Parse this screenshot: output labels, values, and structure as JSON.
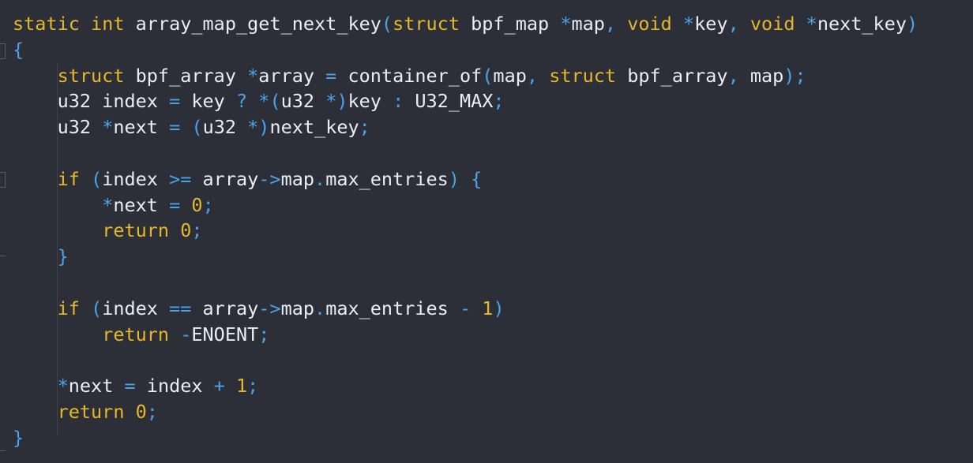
{
  "colors": {
    "background": "#2c2f38",
    "keyword": "#e5b82a",
    "identifier": "#e9eef5",
    "operator": "#4aa3e8"
  },
  "code": {
    "lines": [
      [
        [
          "kw",
          "static"
        ],
        [
          "id",
          " "
        ],
        [
          "kw",
          "int"
        ],
        [
          "id",
          " array_map_get_next_key"
        ],
        [
          "op",
          "("
        ],
        [
          "kw",
          "struct"
        ],
        [
          "id",
          " bpf_map "
        ],
        [
          "op",
          "*"
        ],
        [
          "id",
          "map"
        ],
        [
          "op",
          ","
        ],
        [
          "id",
          " "
        ],
        [
          "kw",
          "void"
        ],
        [
          "id",
          " "
        ],
        [
          "op",
          "*"
        ],
        [
          "id",
          "key"
        ],
        [
          "op",
          ","
        ],
        [
          "id",
          " "
        ],
        [
          "kw",
          "void"
        ],
        [
          "id",
          " "
        ],
        [
          "op",
          "*"
        ],
        [
          "id",
          "next_key"
        ],
        [
          "op",
          ")"
        ]
      ],
      [
        [
          "op",
          "{"
        ]
      ],
      [
        [
          "id",
          "    "
        ],
        [
          "kw",
          "struct"
        ],
        [
          "id",
          " bpf_array "
        ],
        [
          "op",
          "*"
        ],
        [
          "id",
          "array "
        ],
        [
          "op",
          "="
        ],
        [
          "id",
          " container_of"
        ],
        [
          "op",
          "("
        ],
        [
          "id",
          "map"
        ],
        [
          "op",
          ","
        ],
        [
          "id",
          " "
        ],
        [
          "kw",
          "struct"
        ],
        [
          "id",
          " bpf_array"
        ],
        [
          "op",
          ","
        ],
        [
          "id",
          " map"
        ],
        [
          "op",
          ");"
        ]
      ],
      [
        [
          "id",
          "    u32 index "
        ],
        [
          "op",
          "="
        ],
        [
          "id",
          " key "
        ],
        [
          "op",
          "?"
        ],
        [
          "id",
          " "
        ],
        [
          "op",
          "*("
        ],
        [
          "id",
          "u32 "
        ],
        [
          "op",
          "*)"
        ],
        [
          "id",
          "key "
        ],
        [
          "op",
          ":"
        ],
        [
          "id",
          " U32_MAX"
        ],
        [
          "op",
          ";"
        ]
      ],
      [
        [
          "id",
          "    u32 "
        ],
        [
          "op",
          "*"
        ],
        [
          "id",
          "next "
        ],
        [
          "op",
          "="
        ],
        [
          "id",
          " "
        ],
        [
          "op",
          "("
        ],
        [
          "id",
          "u32 "
        ],
        [
          "op",
          "*)"
        ],
        [
          "id",
          "next_key"
        ],
        [
          "op",
          ";"
        ]
      ],
      [],
      [
        [
          "id",
          "    "
        ],
        [
          "kw",
          "if"
        ],
        [
          "id",
          " "
        ],
        [
          "op",
          "("
        ],
        [
          "id",
          "index "
        ],
        [
          "op",
          ">="
        ],
        [
          "id",
          " array"
        ],
        [
          "op",
          "->"
        ],
        [
          "id",
          "map"
        ],
        [
          "op",
          "."
        ],
        [
          "id",
          "max_entries"
        ],
        [
          "op",
          ")"
        ],
        [
          "id",
          " "
        ],
        [
          "op",
          "{"
        ]
      ],
      [
        [
          "id",
          "        "
        ],
        [
          "op",
          "*"
        ],
        [
          "id",
          "next "
        ],
        [
          "op",
          "="
        ],
        [
          "id",
          " "
        ],
        [
          "num",
          "0"
        ],
        [
          "op",
          ";"
        ]
      ],
      [
        [
          "id",
          "        "
        ],
        [
          "kw",
          "return"
        ],
        [
          "id",
          " "
        ],
        [
          "num",
          "0"
        ],
        [
          "op",
          ";"
        ]
      ],
      [
        [
          "id",
          "    "
        ],
        [
          "op",
          "}"
        ]
      ],
      [],
      [
        [
          "id",
          "    "
        ],
        [
          "kw",
          "if"
        ],
        [
          "id",
          " "
        ],
        [
          "op",
          "("
        ],
        [
          "id",
          "index "
        ],
        [
          "op",
          "=="
        ],
        [
          "id",
          " array"
        ],
        [
          "op",
          "->"
        ],
        [
          "id",
          "map"
        ],
        [
          "op",
          "."
        ],
        [
          "id",
          "max_entries "
        ],
        [
          "op",
          "-"
        ],
        [
          "id",
          " "
        ],
        [
          "num",
          "1"
        ],
        [
          "op",
          ")"
        ]
      ],
      [
        [
          "id",
          "        "
        ],
        [
          "kw",
          "return"
        ],
        [
          "id",
          " "
        ],
        [
          "op",
          "-"
        ],
        [
          "id",
          "ENOENT"
        ],
        [
          "op",
          ";"
        ]
      ],
      [],
      [
        [
          "id",
          "    "
        ],
        [
          "op",
          "*"
        ],
        [
          "id",
          "next "
        ],
        [
          "op",
          "="
        ],
        [
          "id",
          " index "
        ],
        [
          "op",
          "+"
        ],
        [
          "id",
          " "
        ],
        [
          "num",
          "1"
        ],
        [
          "op",
          ";"
        ]
      ],
      [
        [
          "id",
          "    "
        ],
        [
          "kw",
          "return"
        ],
        [
          "id",
          " "
        ],
        [
          "num",
          "0"
        ],
        [
          "op",
          ";"
        ]
      ],
      [
        [
          "op",
          "}"
        ]
      ]
    ]
  }
}
